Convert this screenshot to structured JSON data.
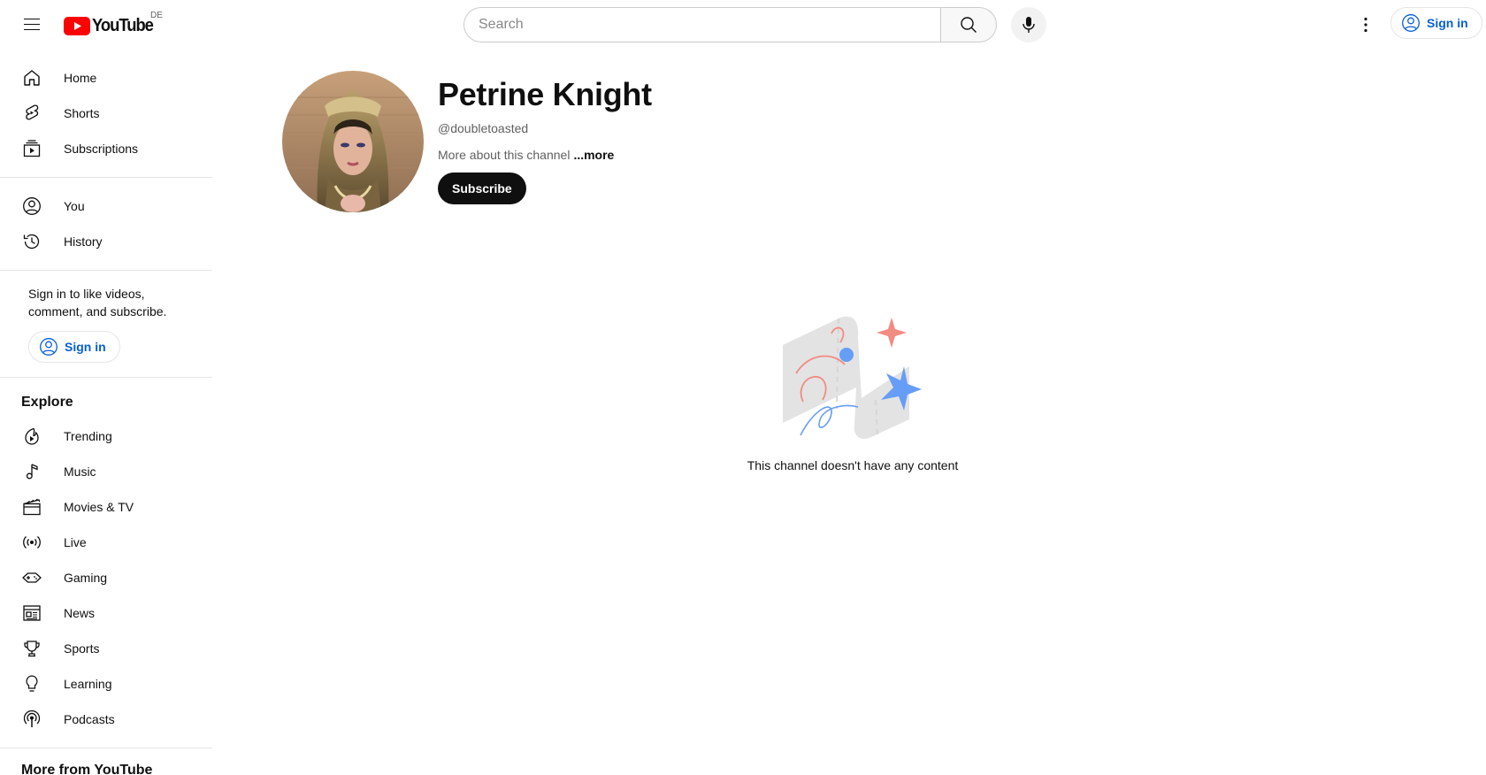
{
  "masthead": {
    "logo_text": "YouTube",
    "region": "DE",
    "search_placeholder": "Search",
    "signin_label": "Sign in"
  },
  "sidebar": {
    "primary": [
      {
        "label": "Home",
        "icon": "home-icon"
      },
      {
        "label": "Shorts",
        "icon": "shorts-icon"
      },
      {
        "label": "Subscriptions",
        "icon": "subscriptions-icon"
      }
    ],
    "you": [
      {
        "label": "You",
        "icon": "account-circle-icon"
      },
      {
        "label": "History",
        "icon": "history-icon"
      }
    ],
    "signin_prompt": "Sign in to like videos, comment, and subscribe.",
    "signin_label": "Sign in",
    "explore_header": "Explore",
    "explore": [
      {
        "label": "Trending",
        "icon": "trending-icon"
      },
      {
        "label": "Music",
        "icon": "music-icon"
      },
      {
        "label": "Movies & TV",
        "icon": "movies-icon"
      },
      {
        "label": "Live",
        "icon": "live-icon"
      },
      {
        "label": "Gaming",
        "icon": "gaming-icon"
      },
      {
        "label": "News",
        "icon": "news-icon"
      },
      {
        "label": "Sports",
        "icon": "sports-icon"
      },
      {
        "label": "Learning",
        "icon": "learning-icon"
      },
      {
        "label": "Podcasts",
        "icon": "podcasts-icon"
      }
    ],
    "more_header": "More from YouTube"
  },
  "channel": {
    "name": "Petrine Knight",
    "handle": "@doubletoasted",
    "about": "More about this channel",
    "more": "...more",
    "subscribe_label": "Subscribe"
  },
  "empty_state": {
    "message": "This channel doesn't have any content"
  },
  "colors": {
    "brand_red": "#ff0000",
    "link_blue": "#065fd4",
    "text_primary": "#0f0f0f",
    "text_secondary": "#606060"
  }
}
